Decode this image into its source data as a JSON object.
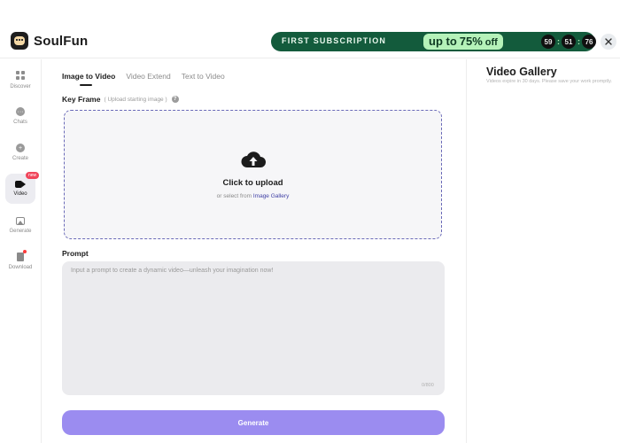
{
  "brand": {
    "name": "SoulFun"
  },
  "promo": {
    "banner_text": "FIRST SUBSCRIPTION",
    "offer_prefix": "up to",
    "offer_percent": "75%",
    "offer_suffix": "off",
    "countdown": {
      "hours": "59",
      "minutes": "51",
      "seconds": "76",
      "separator": ":"
    },
    "colors": {
      "background": "#135b3c",
      "offer_pill": "#b5f2b9"
    }
  },
  "sidebar": {
    "items": [
      {
        "label": "Discover",
        "icon": "grid-icon"
      },
      {
        "label": "Chats",
        "icon": "chat-icon"
      },
      {
        "label": "Create",
        "icon": "plus-circle-icon"
      },
      {
        "label": "Video",
        "icon": "video-camera-icon",
        "badge": "new",
        "active": true
      },
      {
        "label": "Generate",
        "icon": "image-icon"
      },
      {
        "label": "Download",
        "icon": "download-phone-icon",
        "notification_dot": true
      }
    ]
  },
  "tabs": [
    {
      "label": "Image to Video",
      "active": true
    },
    {
      "label": "Video Extend",
      "active": false
    },
    {
      "label": "Text to Video",
      "active": false
    }
  ],
  "keyframe": {
    "label": "Key Frame",
    "sub": "( Upload starting image )",
    "help_icon": "?"
  },
  "upload": {
    "title": "Click to upload",
    "sub_prefix": "or select from",
    "sub_link": "Image Gallery",
    "icon": "cloud-upload-icon"
  },
  "prompt": {
    "label": "Prompt",
    "placeholder": "Input a prompt to create a dynamic video—unleash your imagination now!",
    "counter": "0/800"
  },
  "generate_label": "Generate",
  "gallery": {
    "title": "Video Gallery",
    "subtitle": "Videos expire in 30 days. Please save your work promptly."
  },
  "colors": {
    "accent": "#9b8cf0",
    "upload_border": "#6a6ab8",
    "badge": "#f0455a"
  }
}
